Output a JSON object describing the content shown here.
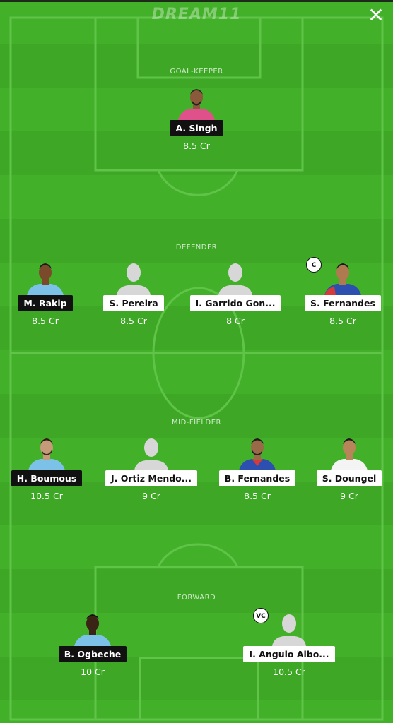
{
  "app": {
    "logo_text": "DREAM11",
    "close_label": "✕"
  },
  "colors": {
    "pitch": "#43b02a",
    "pitch_stripe": "#3ea826",
    "line": "#5fc448",
    "name_dark_bg": "#111111",
    "name_light_bg": "#ffffff"
  },
  "sections": {
    "goalkeeper": "GOAL-KEEPER",
    "defender": "DEFENDER",
    "midfielder": "MID-FIELDER",
    "forward": "FORWARD"
  },
  "players": {
    "gk1": {
      "name": "A. Singh",
      "credits": "8.5 Cr",
      "avatar": "photo",
      "kit": "pink",
      "label_style": "dark"
    },
    "def1": {
      "name": "M. Rakip",
      "credits": "8.5 Cr",
      "avatar": "photo",
      "kit": "sky-blue",
      "label_style": "dark"
    },
    "def2": {
      "name": "S. Pereira",
      "credits": "8.5 Cr",
      "avatar": "silhouette",
      "label_style": "light"
    },
    "def3": {
      "name": "I. Garrido Gon...",
      "credits": "8 Cr",
      "avatar": "silhouette",
      "label_style": "light"
    },
    "def4": {
      "name": "S. Fernandes",
      "credits": "8.5 Cr",
      "avatar": "photo",
      "kit": "blue",
      "label_style": "light",
      "badge": "C"
    },
    "mid1": {
      "name": "H. Boumous",
      "credits": "10.5 Cr",
      "avatar": "photo",
      "kit": "sky-blue",
      "label_style": "dark"
    },
    "mid2": {
      "name": "J. Ortiz Mendo...",
      "credits": "9 Cr",
      "avatar": "silhouette",
      "label_style": "light"
    },
    "mid3": {
      "name": "B. Fernandes",
      "credits": "8.5 Cr",
      "avatar": "photo",
      "kit": "blue",
      "label_style": "light"
    },
    "mid4": {
      "name": "S. Doungel",
      "credits": "9 Cr",
      "avatar": "photo",
      "kit": "white",
      "label_style": "light"
    },
    "fwd1": {
      "name": "B. Ogbeche",
      "credits": "10 Cr",
      "avatar": "photo",
      "kit": "sky-blue",
      "label_style": "dark"
    },
    "fwd2": {
      "name": "I. Angulo Albo...",
      "credits": "10.5 Cr",
      "avatar": "silhouette",
      "label_style": "light",
      "badge": "VC"
    }
  }
}
